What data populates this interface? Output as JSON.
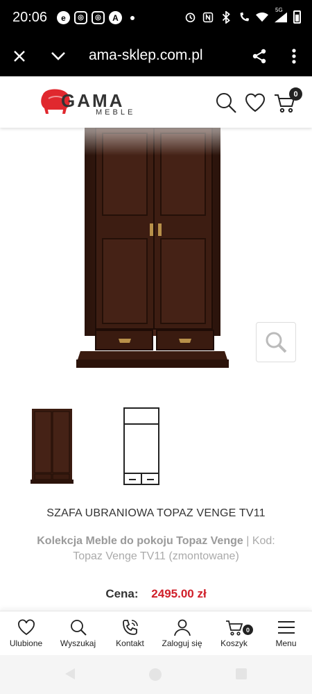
{
  "statusbar": {
    "time": "20:06",
    "left_icons": [
      "e",
      "◎",
      "◎",
      "A"
    ],
    "network": "5G"
  },
  "browser": {
    "url": "ama-sklep.com.pl",
    "close_icon": "close-icon",
    "chevron_icon": "chevron-down-icon",
    "share_icon": "share-icon",
    "menu_icon": "more-vert-icon"
  },
  "header": {
    "logo_main": "GAMA",
    "logo_sub": "MEBLE",
    "cart_count": "0"
  },
  "product": {
    "title": "SZAFA UBRANIOWA TOPAZ VENGE TV11",
    "collection_label": "Kolekcja Meble do pokoju Topaz Venge",
    "separator": "|",
    "code_label": "Kod:",
    "code_value": "Topaz Venge TV11 (zmontowane)",
    "price_label": "Cena:",
    "price_value": "2495.00 zł"
  },
  "bottom_nav": {
    "items": [
      {
        "label": "Ulubione",
        "icon": "heart-icon"
      },
      {
        "label": "Wyszukaj",
        "icon": "search-icon"
      },
      {
        "label": "Kontakt",
        "icon": "phone-icon"
      },
      {
        "label": "Zaloguj się",
        "icon": "user-icon"
      },
      {
        "label": "Koszyk",
        "icon": "cart-icon",
        "badge": "0"
      },
      {
        "label": "Menu",
        "icon": "hamburger-icon"
      }
    ]
  },
  "colors": {
    "price": "#d0202a",
    "wood": "#3b1d12",
    "logo_red": "#e0282e"
  }
}
